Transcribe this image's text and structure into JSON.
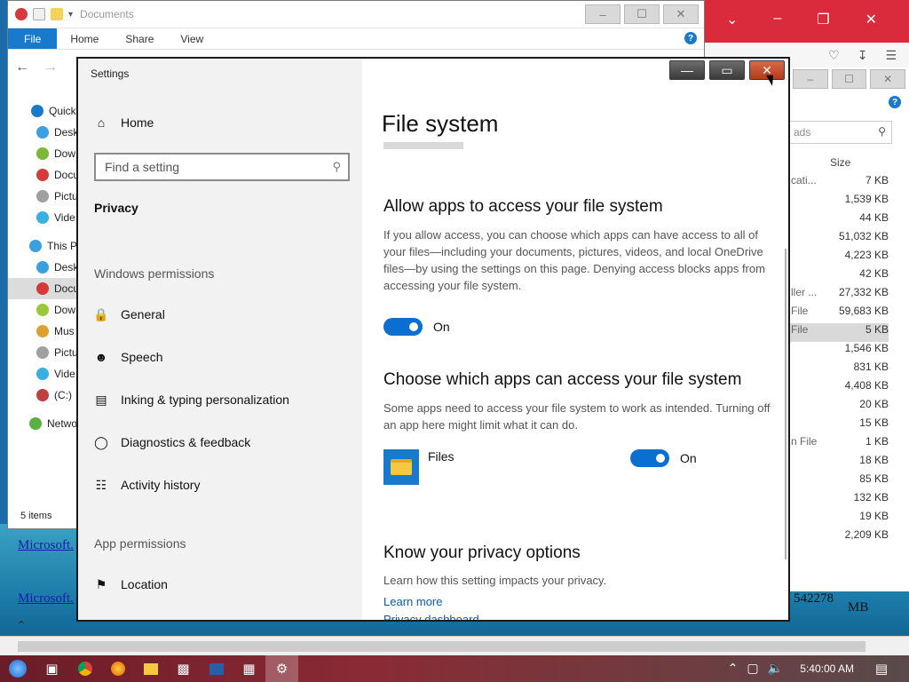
{
  "explorer": {
    "title": "Documents",
    "ribbon_tabs": [
      "File",
      "Home",
      "Share",
      "View"
    ],
    "help": "?",
    "tree": [
      {
        "label": "Quick",
        "color": "#1979ca"
      },
      {
        "label": "Desk",
        "color": "#3aa0e0"
      },
      {
        "label": "Dow",
        "color": "#7ab83a"
      },
      {
        "label": "Docu",
        "color": "#d63a3a"
      },
      {
        "label": "Pictu",
        "color": "#a0a0a0"
      },
      {
        "label": "Vide",
        "color": "#3ab0e0"
      },
      {
        "label": "This P",
        "color": "#3aa0e0"
      },
      {
        "label": "Desk",
        "color": "#3aa0e0"
      },
      {
        "label": "Docu",
        "color": "#d63a3a"
      },
      {
        "label": "Dow",
        "color": "#9ac83a"
      },
      {
        "label": "Mus",
        "color": "#e0a030"
      },
      {
        "label": "Pictu",
        "color": "#a0a0a0"
      },
      {
        "label": "Vide",
        "color": "#3ab0e0"
      },
      {
        "label": "(C:)",
        "color": "#c04040"
      },
      {
        "label": "Netwo",
        "color": "#5ab040"
      }
    ],
    "status": "5 items"
  },
  "explorer2": {
    "search_placeholder": "ads",
    "size_header": "Size",
    "rows": [
      {
        "name": "cati...",
        "size": "7 KB"
      },
      {
        "name": "",
        "size": "1,539 KB"
      },
      {
        "name": "",
        "size": "44 KB"
      },
      {
        "name": "",
        "size": "51,032 KB"
      },
      {
        "name": "",
        "size": "4,223 KB"
      },
      {
        "name": "",
        "size": "42 KB"
      },
      {
        "name": "ller ...",
        "size": "27,332 KB"
      },
      {
        "name": "File",
        "size": "59,683 KB"
      },
      {
        "name": "File",
        "size": "5 KB"
      },
      {
        "name": "",
        "size": "1,546 KB"
      },
      {
        "name": "",
        "size": "831 KB"
      },
      {
        "name": "",
        "size": "4,408 KB"
      },
      {
        "name": "",
        "size": "20 KB"
      },
      {
        "name": "",
        "size": "15 KB"
      },
      {
        "name": "n File",
        "size": "1 KB"
      },
      {
        "name": "",
        "size": "18 KB"
      },
      {
        "name": "",
        "size": "85 KB"
      },
      {
        "name": "",
        "size": "132 KB"
      },
      {
        "name": "",
        "size": "19 KB"
      },
      {
        "name": "",
        "size": "2,209 KB"
      }
    ]
  },
  "desktop_links": [
    "Microsoft.",
    "Microsoft."
  ],
  "desktop_num": "542278",
  "desktop_unit": "MB",
  "settings": {
    "app_title": "Settings",
    "home": "Home",
    "search_placeholder": "Find a setting",
    "privacy": "Privacy",
    "windows_permissions": "Windows permissions",
    "nav": [
      {
        "label": "General",
        "icon": "lock-icon"
      },
      {
        "label": "Speech",
        "icon": "speech-icon"
      },
      {
        "label": "Inking & typing personalization",
        "icon": "clipboard-icon"
      },
      {
        "label": "Diagnostics & feedback",
        "icon": "feedback-icon"
      },
      {
        "label": "Activity history",
        "icon": "timeline-icon"
      }
    ],
    "app_permissions": "App permissions",
    "location": "Location",
    "page_title": "File system",
    "allow_heading": "Allow apps to access your file system",
    "allow_desc": "If you allow access, you can choose which apps can have access to all of your files—including your documents, pictures, videos, and local OneDrive files—by using the settings on this page. Denying access blocks apps from accessing your file system.",
    "allow_toggle": "On",
    "choose_heading": "Choose which apps can access your file system",
    "choose_desc": "Some apps need to access your file system to work as intended. Turning off an app here might limit what it can do.",
    "app_name": "Files",
    "app_toggle": "On",
    "know_heading": "Know your privacy options",
    "know_desc": "Learn how this setting impacts your privacy.",
    "learn_more": "Learn more",
    "privacy_dashboard": "Privacy dashboard"
  },
  "taskbar": {
    "clock": "5:40:00 AM"
  }
}
